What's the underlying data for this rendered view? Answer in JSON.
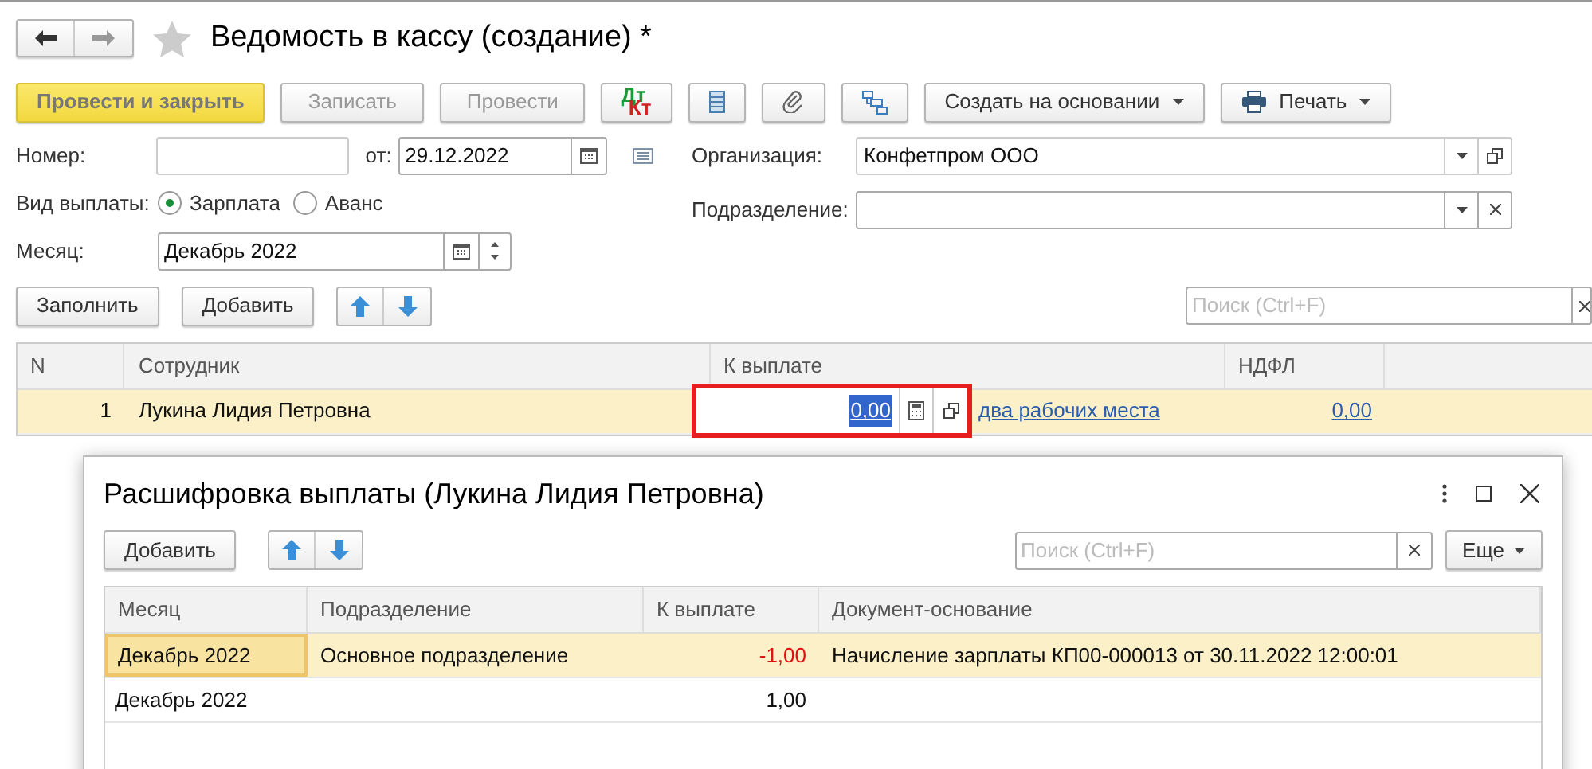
{
  "window": {
    "title": "Ведомость в кассу (создание) *",
    "favorite": false
  },
  "toolbar": [
    {
      "kind": "primary",
      "label": "Провести и закрыть"
    },
    {
      "kind": "text",
      "label": "Записать"
    },
    {
      "kind": "text",
      "label": "Провести"
    },
    {
      "kind": "dtkt",
      "label": "Дт",
      "label2": "Кт"
    },
    {
      "kind": "list"
    },
    {
      "kind": "clip"
    },
    {
      "kind": "structure"
    },
    {
      "kind": "dropdown",
      "label": "Создать на основании"
    },
    {
      "kind": "print",
      "label": "Печать"
    }
  ],
  "fields": {
    "number": {
      "label": "Номер:"
    },
    "date": {
      "label": "от:",
      "value": "29.12.2022"
    },
    "organization": {
      "label": "Организация:",
      "value": "Конфетпром ООО"
    },
    "department": {
      "label": "Подразделение:"
    },
    "payment_type": {
      "label": "Вид выплаты:",
      "options": [
        {
          "label": "Зарплата",
          "selected": true
        },
        {
          "label": "Аванс",
          "selected": false
        }
      ]
    },
    "month": {
      "label": "Месяц:",
      "value": "Декабрь 2022"
    }
  },
  "table_toolbar": {
    "buttons": [
      "Заполнить",
      "Добавить"
    ],
    "search": {
      "placeholder": "Поиск (Ctrl+F)"
    }
  },
  "table": {
    "columns": [
      "N",
      "Сотрудник",
      "К выплате",
      "НДФЛ"
    ],
    "rows": [
      {
        "n": "1",
        "employee": "Лукина Лидия Петровна",
        "amount": "0,00",
        "link": "два рабочих места",
        "ndfl": "0,00",
        "selected": true
      }
    ]
  },
  "dialog": {
    "title": "Расшифровка выплаты (Лукина Лидия Петровна)",
    "add": "Добавить",
    "search": {
      "placeholder": "Поиск (Ctrl+F)"
    },
    "more": "Еще",
    "columns": [
      "Месяц",
      "Подразделение",
      "К выплате",
      "Документ-основание"
    ],
    "rows": [
      {
        "month": "Декабрь 2022",
        "department": "Основное подразделение",
        "amount": "-1,00",
        "negative": true,
        "document": "Начисление зарплаты КП00-000013 от 30.11.2022 12:00:01",
        "selected": true
      },
      {
        "month": "Декабрь 2022",
        "amount": "1,00",
        "negative": false,
        "selected": false
      }
    ]
  }
}
